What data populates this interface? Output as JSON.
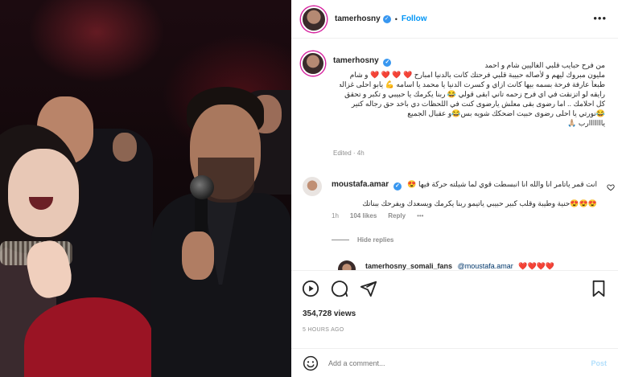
{
  "header": {
    "username": "tamerhosny",
    "separator": "•",
    "follow_label": "Follow",
    "more_label": "•••"
  },
  "caption": {
    "username": "tamerhosny",
    "lines": [
      "من فرح حبايب قلبي الغاليين شام و احمد",
      "مليون مبروك ليهم و لأصاله حبيبة قلبي فرحتك كانت بالدنيا امبارح ❤️ ❤️ ❤️ ❤️ و شام",
      "طبعاً عارفة فرحة بسمه بيها كانت ازاي و كسرت الدنيا يا محمد يا اسامه 💪 يابو احلى غزاله",
      "رايقه لو اتزنقت في اي فرح زحمه تاني ابقى قولي 😂 ربنا يكرمك يا حبيبي و تكبر و تحقق",
      "كل احلامك .. اما رضوى بقى معلش يارضوى كنت في اللحظات دي باخد حق رجاله كتير",
      "😂نورتي يا احلى رضوى حبيت اضحكك شويه بس😂و عقبال الجميع",
      "يااااااارب 🙏🏼"
    ],
    "edited_text": "Edited · 4h"
  },
  "comment": {
    "username": "moustafa.amar",
    "lines": [
      "انت قمر ياتامر انا والله انا انبسطت قوي لما شيلته حركة فيها 😍",
      "😍😍😍حنية وطيبة وقلب كبير حبيبي ياتيمو ربنا يكرمك ويسعدك ويفرحك ببناتك"
    ],
    "time": "1h",
    "likes": "104 likes",
    "reply_label": "Reply",
    "more_label": "•••",
    "hide_replies": "Hide replies"
  },
  "reply": {
    "username": "tamerhosny_somali_fans",
    "mention": "@moustafa.amar",
    "hearts": "❤️❤️❤️❤️"
  },
  "stats": {
    "views": "354,728 views",
    "posted": "5 HOURS AGO"
  },
  "composer": {
    "placeholder": "Add a comment...",
    "post_label": "Post"
  },
  "colors": {
    "accent": "#0095f6",
    "verified": "#3897f0",
    "story_ring": "#d6249f",
    "heart": "#ed4956"
  },
  "icons": {
    "verified": "check-badge-icon",
    "play": "play-icon",
    "comment": "comment-bubble-icon",
    "share": "paper-plane-icon",
    "save": "bookmark-icon",
    "emoji": "smiley-icon",
    "like_comment": "heart-outline-icon"
  }
}
